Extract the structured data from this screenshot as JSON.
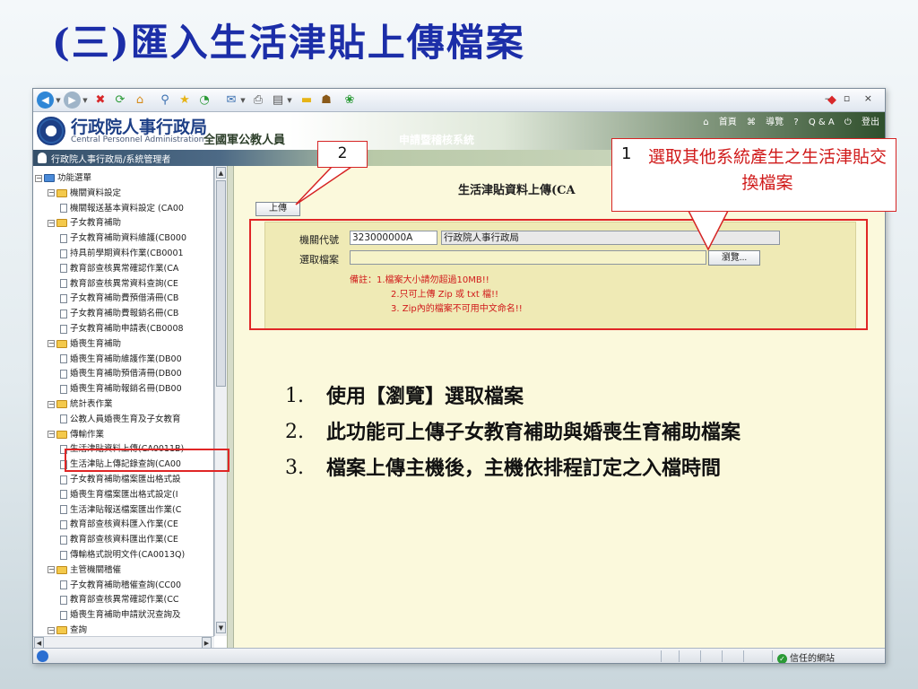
{
  "slide": {
    "title": "(三)匯入生活津貼上傳檔案",
    "bullets": [
      {
        "num": "1.",
        "text": "使用【瀏覽】選取檔案"
      },
      {
        "num": "2.",
        "text": "此功能可上傳子女教育補助與婚喪生育補助檔案"
      },
      {
        "num": "3.",
        "text": "檔案上傳主機後，主機依排程訂定之入檔時間"
      }
    ],
    "callout_1": {
      "num": "1",
      "text": "選取其他系統產生之生活津貼交換檔案"
    },
    "callout_2": {
      "num": "2"
    },
    "highlight_color": "#e02626"
  },
  "browser": {
    "window_controls": "– ▫ ×",
    "status": {
      "trusted_site": "信任的網站"
    }
  },
  "app": {
    "org_name": "行政院人事行政局",
    "org_en": "Central Personnel Administration",
    "system_name": "全國軍公教人員",
    "system_sub": "申請暨稽核系統",
    "top_links": {
      "home": "首頁",
      "guide": "導覽",
      "qa": "Q & A",
      "logout": "登出"
    },
    "user_info": "行政院人事行政局/系統管理者"
  },
  "sidebar": {
    "items": [
      {
        "level": 0,
        "type": "root",
        "label": "功能選單"
      },
      {
        "level": 1,
        "type": "folder",
        "label": "機關資料設定"
      },
      {
        "level": 2,
        "type": "doc",
        "label": "機關報送基本資料設定 (CA00"
      },
      {
        "level": 1,
        "type": "folder",
        "label": "子女教育補助"
      },
      {
        "level": 2,
        "type": "doc",
        "label": "子女教育補助資料維護(CB000"
      },
      {
        "level": 2,
        "type": "doc",
        "label": "持具前學期資料作業(CB0001"
      },
      {
        "level": 2,
        "type": "doc",
        "label": "教育部查核異常確認作業(CA"
      },
      {
        "level": 2,
        "type": "doc",
        "label": "教育部查核異常資料查詢(CE"
      },
      {
        "level": 2,
        "type": "doc",
        "label": "子女教育補助費預借清冊(CB"
      },
      {
        "level": 2,
        "type": "doc",
        "label": "子女教育補助費報銷名冊(CB"
      },
      {
        "level": 2,
        "type": "doc",
        "label": "子女教育補助申請表(CB0008"
      },
      {
        "level": 1,
        "type": "folder",
        "label": "婚喪生育補助"
      },
      {
        "level": 2,
        "type": "doc",
        "label": "婚喪生育補助維護作業(DB00"
      },
      {
        "level": 2,
        "type": "doc",
        "label": "婚喪生育補助預借清冊(DB00"
      },
      {
        "level": 2,
        "type": "doc",
        "label": "婚喪生育補助報銷名冊(DB00"
      },
      {
        "level": 1,
        "type": "folder",
        "label": "統計表作業"
      },
      {
        "level": 2,
        "type": "doc",
        "label": "公教人員婚喪生育及子女教育"
      },
      {
        "level": 1,
        "type": "folder",
        "label": "傳輸作業"
      },
      {
        "level": 2,
        "type": "doc",
        "label": "生活津貼資料上傳(CA0011B)"
      },
      {
        "level": 2,
        "type": "doc",
        "label": "生活津貼上傳記錄查詢(CA00"
      },
      {
        "level": 2,
        "type": "doc",
        "label": "子女教育補助檔案匯出格式設"
      },
      {
        "level": 2,
        "type": "doc",
        "label": "婚喪生育檔案匯出格式設定(I"
      },
      {
        "level": 2,
        "type": "doc",
        "label": "生活津貼報送檔案匯出作業(C"
      },
      {
        "level": 2,
        "type": "doc",
        "label": "教育部查核資料匯入作業(CE"
      },
      {
        "level": 2,
        "type": "doc",
        "label": "教育部查核資料匯出作業(CE"
      },
      {
        "level": 2,
        "type": "doc",
        "label": "傳輸格式說明文件(CA0013Q)"
      },
      {
        "level": 1,
        "type": "folder",
        "label": "主管機關稽催"
      },
      {
        "level": 2,
        "type": "doc",
        "label": "子女教育補助稽催查詢(CC00"
      },
      {
        "level": 2,
        "type": "doc",
        "label": "教育部查核異常確認作業(CC"
      },
      {
        "level": 2,
        "type": "doc",
        "label": "婚喪生育補助申請狀況查詢及"
      },
      {
        "level": 1,
        "type": "folder",
        "label": "查詢"
      }
    ]
  },
  "main": {
    "title": "生活津貼資料上傳(CA",
    "upload_label": "上傳",
    "form": {
      "agency_code_label": "機關代號",
      "agency_code": "323000000A",
      "agency_name": "行政院人事行政局",
      "file_label": "選取檔案",
      "file_value": "",
      "browse_label": "瀏覽...",
      "notes": [
        "備註：1.檔案大小請勿超過10MB!!",
        "2.只可上傳 Zip 或 txt 檔!!",
        "3. Zip內的檔案不可用中文命名!!"
      ]
    }
  }
}
